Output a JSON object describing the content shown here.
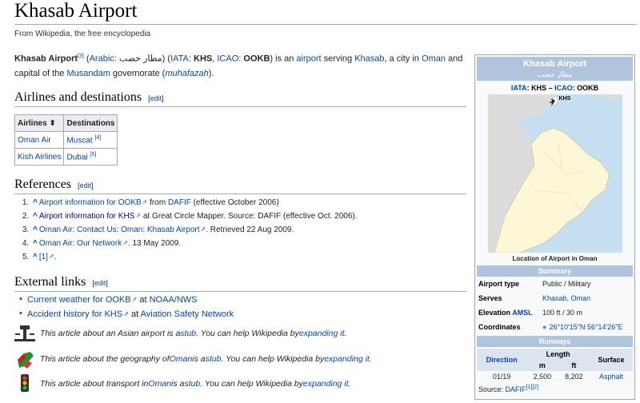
{
  "page": {
    "title": "Khasab Airport",
    "tagline": "From Wikipedia, the free encyclopedia"
  },
  "lead": {
    "name": "Khasab Airport",
    "sup": "[3]",
    "arabic_link": "Arabic",
    "arabic_text": "مطار خصب",
    "iata_link": "IATA",
    "iata": "KHS",
    "icao_link": "ICAO",
    "icao": "OOKB",
    "t1": " (",
    "t2": ": ",
    "t3": ") (",
    "t4": ": ",
    "t5": ", ",
    "t6": ": ",
    "t7": ") is an ",
    "airport_link": "airport",
    "t8": " serving ",
    "khasab_link": "Khasab",
    "t9": ", a city in ",
    "oman_link": "Oman",
    "t10": " and capital of the ",
    "musandam_link": "Musandam",
    "t11": " governorate (",
    "muhafazah_link": "muhafazah",
    "t12": ")."
  },
  "sections": {
    "airlines": "Airlines and destinations",
    "references": "References",
    "external": "External links",
    "edit": "[edit]"
  },
  "airlines_table": {
    "headers": [
      "Airlines ⬍",
      "Destinations"
    ],
    "rows": [
      {
        "airline": "Oman Air",
        "dest": "Muscat",
        "ref": "[4]"
      },
      {
        "airline": "Kish Airlines",
        "dest": "Dubai",
        "ref": "[5]"
      }
    ]
  },
  "references": [
    {
      "link": "Airport information for OOKB",
      "mid": " from ",
      "link2": "DAFIF",
      "rest": " (effective October 2006)"
    },
    {
      "link": "Airport information for KHS",
      "mid": "",
      "link2": "",
      "rest": " at Great Circle Mapper. Source: DAFIF (effective Oct. 2006)."
    },
    {
      "link": "Oman Air: Contact Us: Oman: Khasab Airport",
      "mid": "",
      "link2": "",
      "rest": ". Retrieved 22 Aug 2009."
    },
    {
      "link": "Oman Air: Our Network",
      "mid": "",
      "link2": "",
      "rest": ". 13 May 2009."
    },
    {
      "link": "[1]",
      "mid": "",
      "link2": "",
      "rest": "."
    }
  ],
  "external_links": [
    {
      "link": "Current weather for OOKB",
      "mid": " at ",
      "link2": "NOAA/NWS"
    },
    {
      "link": "Accident history for KHS",
      "mid": " at ",
      "link2": "Aviation Safety Network"
    }
  ],
  "stubs": [
    {
      "pre": "This article about an Asian airport is a ",
      "stub": "stub",
      "mid": ". You can help Wikipedia by ",
      "expand": "expanding it",
      "post": "."
    },
    {
      "pre": "This article about the geography of ",
      "topic": "Oman",
      "pre2": " is a ",
      "stub": "stub",
      "mid": ". You can help Wikipedia by ",
      "expand": "expanding it",
      "post": "."
    },
    {
      "pre": "This article about transport in ",
      "topic": "Oman",
      "pre2": " is a ",
      "stub": "stub",
      "mid": ". You can help Wikipedia by ",
      "expand": "expanding it",
      "post": "."
    }
  ],
  "infobox": {
    "title": "Khasab Airport",
    "arabic": "مطار خصب",
    "iata_label": "IATA",
    "iata": "KHS",
    "sep": " – ",
    "icao_label": "ICAO",
    "icao": "OOKB",
    "code_sep": ": ",
    "map_label": "KHS",
    "caption": "Location of Airport in Oman",
    "summary": "Summary",
    "rows": [
      {
        "label": "Airport type",
        "value": "Public / Military"
      },
      {
        "label": "Serves",
        "value": "Khasab, Oman"
      },
      {
        "label": "Elevation",
        "label_link": "AMSL",
        "value": "100 ft / 30 m"
      },
      {
        "label": "Coordinates",
        "value": "26°10′15″N 56°14′26″E"
      }
    ],
    "runways": "Runways",
    "rw_head": {
      "direction": "Direction",
      "length": "Length",
      "surface": "Surface",
      "m": "m",
      "ft": "ft"
    },
    "rw_row": {
      "direction": "01/19",
      "m": "2,500",
      "ft": "8,202",
      "surface": "Asphalt"
    },
    "source_label": "Source: ",
    "source_link": "DAFIF",
    "source_refs": "[1][2]"
  },
  "colors": {
    "link": "#0645ad",
    "band": "#b0c4de",
    "sea": "#c6dff1",
    "land": "#fdf7d8",
    "other_land": "#dcdcdc"
  }
}
